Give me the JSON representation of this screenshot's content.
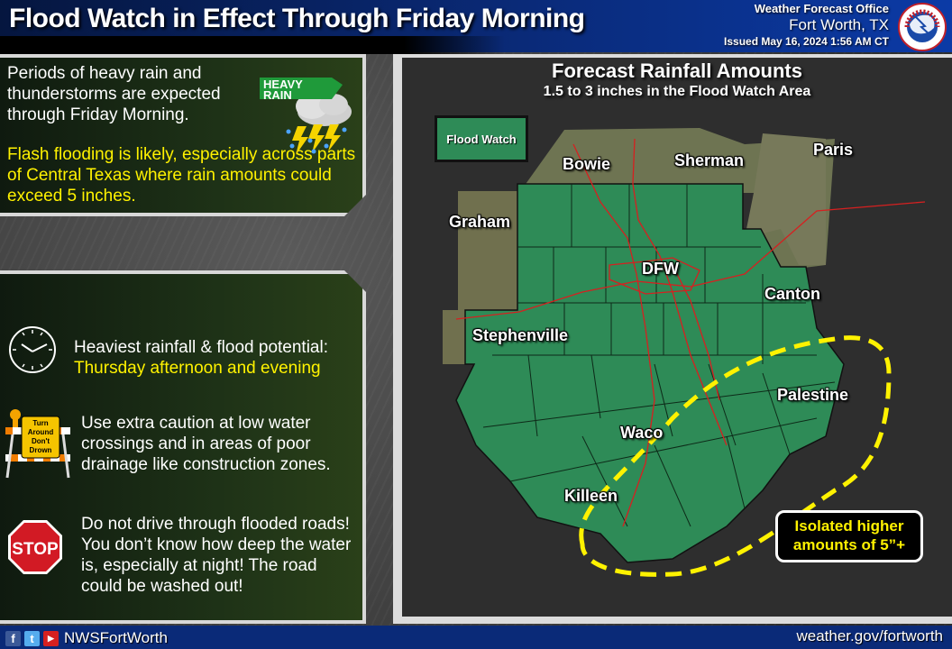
{
  "header": {
    "title": "Flood Watch in Effect Through Friday Morning",
    "office_line1": "Weather Forecast Office",
    "office_line2": "Fort Worth, TX",
    "issued": "Issued May 16, 2024 1:56 AM CT",
    "logo_icon": "nws-logo-icon"
  },
  "summary_panel": {
    "text1": "Periods of heavy rain and thunderstorms are expected through Friday Morning.",
    "text2": "Flash flooding is likely, especially across parts of Central Texas where rain amounts could exceed 5 inches.",
    "badge_line1": "HEAVY",
    "badge_line2": "RAIN",
    "icon": "heavy-rain-thunderstorm-icon"
  },
  "safety_panel": {
    "items": [
      {
        "icon": "clock-icon",
        "line1": "Heaviest rainfall & flood potential:",
        "line2": "Thursday afternoon and evening"
      },
      {
        "icon": "turn-around-dont-drown-barricade-icon",
        "sign_text": [
          "Turn",
          "Around",
          "Don't",
          "Drown"
        ],
        "text": "Use extra caution at low water crossings and in areas of poor drainage like construction zones."
      },
      {
        "icon": "stop-sign-icon",
        "sign_text": "STOP",
        "text": "Do not drive through flooded roads! You don’t know how deep the water is, especially at night! The road could be washed out!"
      }
    ]
  },
  "map": {
    "title": "Forecast Rainfall Amounts",
    "subtitle": "1.5 to 3 inches in the Flood Watch Area",
    "legend_label": "Flood Watch",
    "colors": {
      "flood_watch": "#2e8b57",
      "highlight_outline": "#fff200",
      "roads": "#d62020"
    },
    "cities": [
      "Bowie",
      "Sherman",
      "Paris",
      "Graham",
      "DFW",
      "Canton",
      "Stephenville",
      "Palestine",
      "Waco",
      "Killeen"
    ],
    "callout": "Isolated higher amounts of 5”+"
  },
  "footer": {
    "social_icons": [
      "facebook-icon",
      "twitter-icon",
      "youtube-icon"
    ],
    "handle": "NWSFortWorth",
    "website": "weather.gov/fortworth"
  }
}
